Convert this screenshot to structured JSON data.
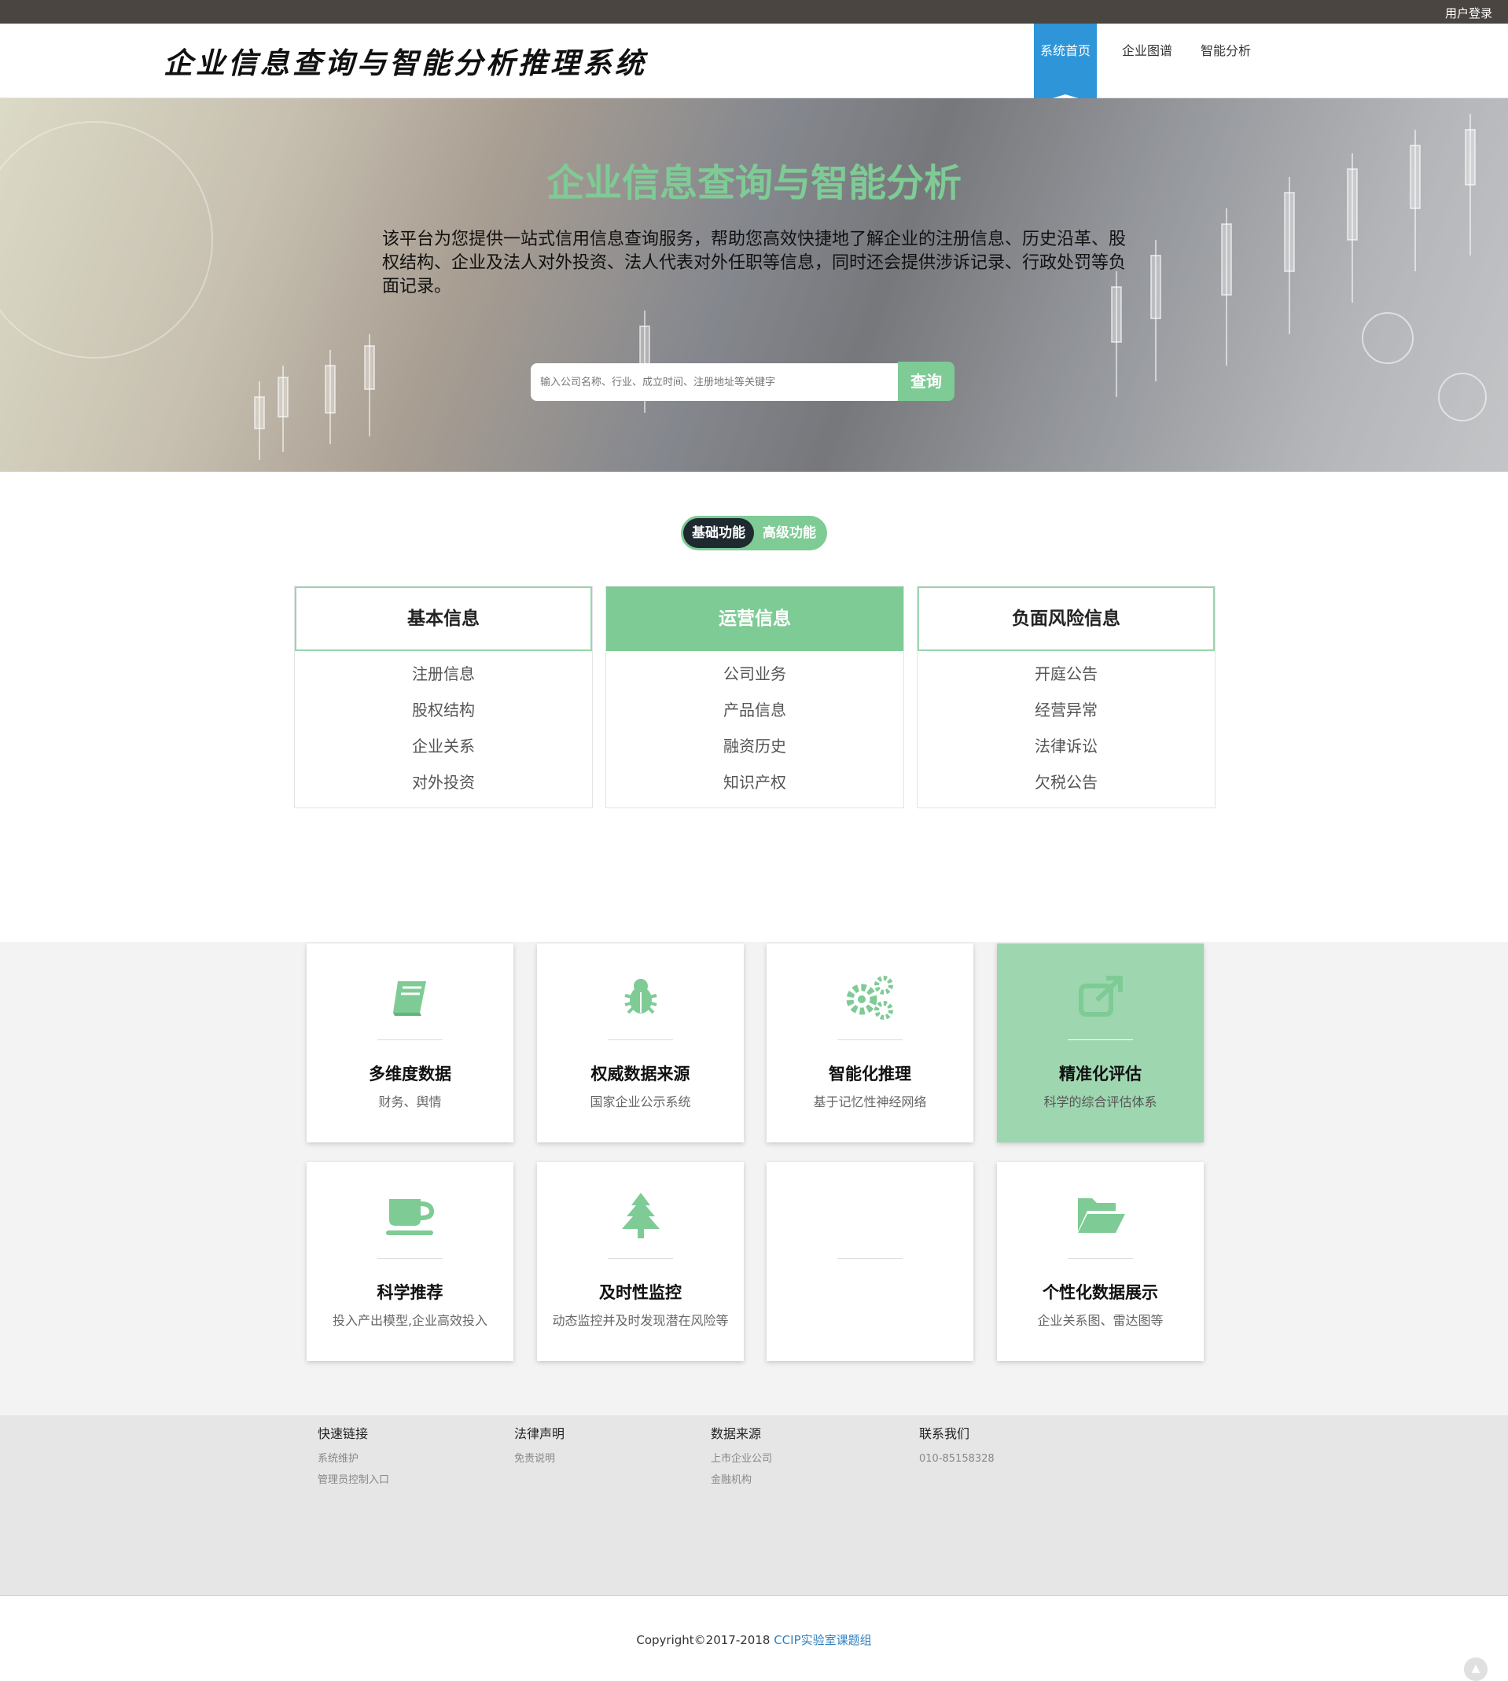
{
  "topbar": {
    "login": "用户登录"
  },
  "header": {
    "logo": "企业信息查询与智能分析推理系统",
    "nav": [
      "系统首页",
      "企业图谱",
      "智能分析"
    ]
  },
  "hero": {
    "title": "企业信息查询与智能分析",
    "desc": "该平台为您提供一站式信用信息查询服务，帮助您高效快捷地了解企业的注册信息、历史沿革、股权结构、企业及法人对外投资、法人代表对外任职等信息，同时还会提供涉诉记录、行政处罚等负面记录。",
    "search_placeholder": "输入公司名称、行业、成立时间、注册地址等关键字",
    "search_button": "查询"
  },
  "toggle": {
    "basic": "基础功能",
    "advanced": "高级功能"
  },
  "categories": [
    {
      "title": "基本信息",
      "items": [
        "注册信息",
        "股权结构",
        "企业关系",
        "对外投资"
      ]
    },
    {
      "title": "运营信息",
      "items": [
        "公司业务",
        "产品信息",
        "融资历史",
        "知识产权"
      ]
    },
    {
      "title": "负面风险信息",
      "items": [
        "开庭公告",
        "经营异常",
        "法律诉讼",
        "欠税公告"
      ]
    }
  ],
  "features": [
    {
      "icon": "book-icon",
      "title": "多维度数据",
      "desc": "财务、舆情"
    },
    {
      "icon": "bug-icon",
      "title": "权威数据来源",
      "desc": "国家企业公示系统"
    },
    {
      "icon": "gears-icon",
      "title": "智能化推理",
      "desc": "基于记忆性神经网络"
    },
    {
      "icon": "external-link-icon",
      "title": "精准化评估",
      "desc": "科学的综合评估体系"
    },
    {
      "icon": "coffee-icon",
      "title": "科学推荐",
      "desc": "投入产出模型,企业高效投入"
    },
    {
      "icon": "tree-icon",
      "title": "及时性监控",
      "desc": "动态监控并及时发现潜在风险等"
    },
    {
      "icon": "",
      "title": "",
      "desc": ""
    },
    {
      "icon": "folder-open-icon",
      "title": "个性化数据展示",
      "desc": "企业关系图、雷达图等"
    }
  ],
  "footer": {
    "cols": [
      {
        "title": "快速链接",
        "links": [
          "系统维护",
          "管理员控制入口"
        ]
      },
      {
        "title": "法律声明",
        "links": [
          "免责说明"
        ]
      },
      {
        "title": "数据来源",
        "links": [
          "上市企业公司",
          "金融机构"
        ]
      },
      {
        "title": "联系我们",
        "links": [
          "010-85158328"
        ]
      }
    ],
    "copyright": "Copyright©2017-2018 ",
    "copyright_link": "CCIP实验室课题组"
  },
  "colors": {
    "accent": "#7ecb95",
    "nav_active": "#2e95d8",
    "dark": "#1e2a30"
  }
}
